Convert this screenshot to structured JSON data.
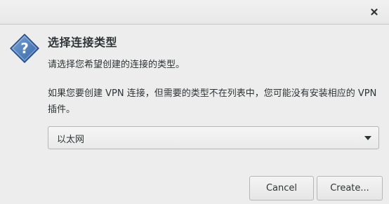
{
  "titlebar": {
    "close_icon": "close-icon"
  },
  "header": {
    "icon": "question-icon",
    "title": "选择连接类型",
    "subtitle": "请选择您希望创建的连接的类型。"
  },
  "body": {
    "note": "如果您要创建 VPN 连接，但需要的类型不在列表中，您可能没有安装相应的 VPN 插件。"
  },
  "connection_type_select": {
    "selected_value": "以太网",
    "arrow_icon": "chevron-down-icon"
  },
  "buttons": {
    "cancel_label": "Cancel",
    "create_label": "Create..."
  },
  "colors": {
    "accent": "#3465a4",
    "background": "#ededed",
    "text": "#2e3436"
  }
}
